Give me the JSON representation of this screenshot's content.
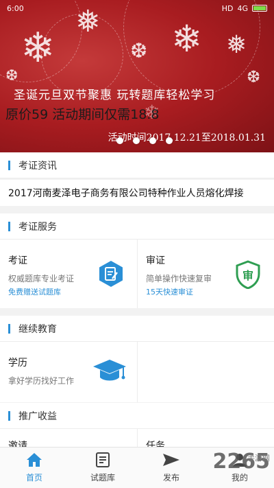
{
  "status_bar": {
    "time": "6:00",
    "network": "4G",
    "signal": "HD"
  },
  "banner": {
    "line1": "圣诞元旦双节聚惠  玩转题库轻松学习",
    "line2": "原价59 活动期间仅需18.8",
    "line3": "活动时间2017.12.21至2018.01.31",
    "dot_count": 4,
    "icon": "snowflake-icon"
  },
  "sections": {
    "news": {
      "title": "考证资讯",
      "headline": "2017河南麦泽电子商务有限公司特种作业人员熔化焊接"
    },
    "services": {
      "title": "考证服务",
      "cards": [
        {
          "title": "考证",
          "sub": "权威题库专业考证",
          "tag": "免费赠送试题库",
          "icon": "edit-document-icon"
        },
        {
          "title": "审证",
          "sub": "简单操作快速复审",
          "tag": "15天快速审证",
          "icon": "shield-review-icon"
        }
      ]
    },
    "education": {
      "title": "继续教育",
      "cards": [
        {
          "title": "学历",
          "sub": "拿好学历找好工作",
          "icon": "graduation-cap-icon"
        }
      ]
    },
    "promotion": {
      "title": "推广收益",
      "partial_left": "邀请",
      "partial_right": "任务"
    }
  },
  "tabs": [
    {
      "label": "首页",
      "icon": "home-icon",
      "active": true
    },
    {
      "label": "试题库",
      "icon": "question-bank-icon",
      "active": false
    },
    {
      "label": "发布",
      "icon": "send-icon",
      "active": false
    },
    {
      "label": "我的",
      "icon": "user-icon",
      "active": false
    }
  ],
  "watermark": {
    "text": "2265",
    "sub": "手游网"
  },
  "colors": {
    "accent": "#2a8fd6",
    "banner_red": "#a81c20",
    "review_green": "#2f9e52"
  }
}
